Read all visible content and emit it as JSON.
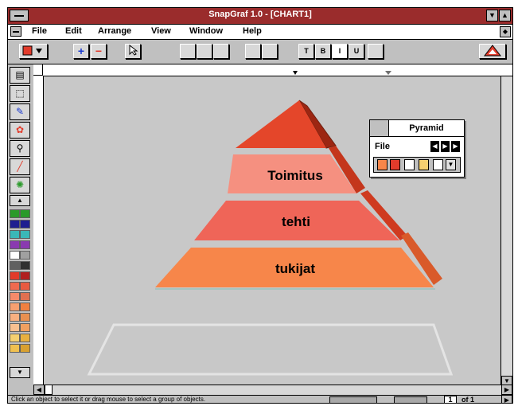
{
  "window": {
    "title": "SnapGraf 1.0 - [CHART1]"
  },
  "menu": [
    "File",
    "Edit",
    "Arrange",
    "View",
    "Window",
    "Help"
  ],
  "toolbar": {
    "text_tools": [
      "T",
      "B",
      "I",
      "U"
    ]
  },
  "pyramid": {
    "levels": [
      "Toimitus",
      "tehti",
      "tukijat"
    ],
    "colors": {
      "apex": "#e4462a",
      "tier1": "#f59080",
      "tier2": "#ef6558",
      "tier3": "#f7864a",
      "side": "#c4361c"
    }
  },
  "palette": {
    "title": "Pyramid",
    "file_label": "File"
  },
  "status": {
    "message": "Click an object to select it or drag mouse to select a group of objects.",
    "page_current": "1",
    "page_of": "of 1"
  },
  "colors": {
    "title_bar": "#9a2c2c",
    "accent": "#e23b2b"
  }
}
